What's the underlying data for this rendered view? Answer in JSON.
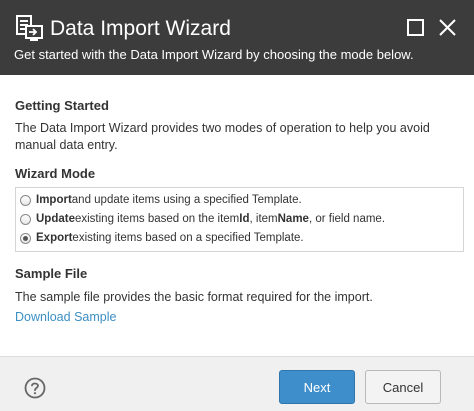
{
  "header": {
    "title": "Data Import Wizard",
    "subtitle": "Get started with the Data Import Wizard by choosing the mode below.",
    "icon": "data-import-icon",
    "maximize_icon": "maximize-icon",
    "close_icon": "close-icon"
  },
  "getting_started": {
    "heading": "Getting Started",
    "line1": "The Data Import Wizard provides two modes of operation to help you avoid",
    "line2": "manual data entry."
  },
  "wizard_mode": {
    "heading": "Wizard Mode",
    "options": [
      {
        "bold": "Import",
        "rest": " and update items using a specified Template.",
        "selected": false
      },
      {
        "bold": "Update",
        "pre": " existing items based on the item ",
        "id": "Id",
        "mid": ", item ",
        "name": "Name",
        "post": ", or field name.",
        "selected": false
      },
      {
        "bold": "Export",
        "rest": " existing items based on a specified Template.",
        "selected": true
      }
    ]
  },
  "sample_file": {
    "heading": "Sample File",
    "text": "The sample file provides the basic format required for the import.",
    "link": "Download Sample"
  },
  "footer": {
    "help_icon": "help-icon",
    "next_label": "Next",
    "cancel_label": "Cancel"
  },
  "colors": {
    "header_bg": "#3c3c3c",
    "primary_button": "#3e8ecb",
    "link": "#3b8fc4",
    "footer_bg": "#f0f0f0"
  }
}
